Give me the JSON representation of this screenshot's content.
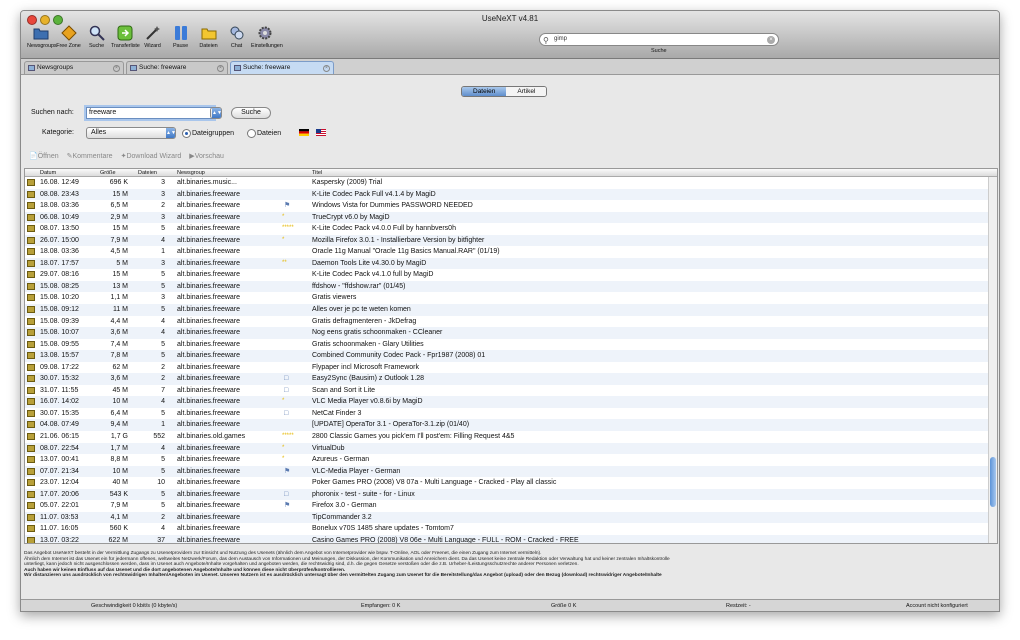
{
  "window": {
    "title": "UseNeXT v4.81"
  },
  "toolbar": [
    {
      "label": "Newsgroups",
      "icon": "folder-icon"
    },
    {
      "label": "Free Zone",
      "icon": "free-zone-icon"
    },
    {
      "label": "Suche",
      "icon": "search-icon"
    },
    {
      "label": "Transferliste",
      "icon": "transfer-icon"
    },
    {
      "label": "Wizard",
      "icon": "wizard-icon"
    },
    {
      "label": "Pause",
      "icon": "pause-icon"
    },
    {
      "label": "Dateien",
      "icon": "folder-icon"
    },
    {
      "label": "Chat",
      "icon": "chat-icon"
    },
    {
      "label": "Einstellungen",
      "icon": "gear-icon"
    }
  ],
  "search": {
    "value": "gimp",
    "label": "Suche"
  },
  "tabs": [
    {
      "label": "Newsgroups"
    },
    {
      "label": "Suche: freeware"
    },
    {
      "label": "Suche: freeware"
    }
  ],
  "segments": {
    "files": "Dateien",
    "articles": "Artikel"
  },
  "form": {
    "search_label": "Suchen nach:",
    "search_value": "freeware",
    "search_button": "Suche",
    "category_label": "Kategorie:",
    "category_value": "Alles",
    "radio_groups": "Dateigruppen",
    "radio_files": "Dateien"
  },
  "actions": [
    "Öffnen",
    "Kommentare",
    "Download Wizard",
    "Vorschau"
  ],
  "columns": {
    "date": "Datum",
    "size": "Größe",
    "files": "Dateien",
    "group": "Newsgroup",
    "title": "Titel"
  },
  "rows": [
    {
      "date": "16.08. 12:49",
      "size": "696 K",
      "files": "3",
      "group": "alt.binaries.music...",
      "mark": "",
      "title": "Kaspersky (2009) Trial"
    },
    {
      "date": "08.08. 23:43",
      "size": "15 M",
      "files": "3",
      "group": "alt.binaries.freeware",
      "mark": "",
      "title": "K-Lite Codec Pack Full v4.1.4 by MagiD"
    },
    {
      "date": "18.08. 03:36",
      "size": "6,5 M",
      "files": "2",
      "group": "alt.binaries.freeware",
      "mark": "flag",
      "title": "Windows Vista for Dummies   PASSWORD NEEDED"
    },
    {
      "date": "06.08. 10:49",
      "size": "2,9 M",
      "files": "3",
      "group": "alt.binaries.freeware",
      "mark": "*",
      "title": "TrueCrypt v6.0 by MagiD"
    },
    {
      "date": "08.07. 13:50",
      "size": "15 M",
      "files": "5",
      "group": "alt.binaries.freeware",
      "mark": "*****",
      "title": "K-Lite Codec Pack v4.0.0 Full by hannbvers0h"
    },
    {
      "date": "26.07. 15:00",
      "size": "7,9 M",
      "files": "4",
      "group": "alt.binaries.freeware",
      "mark": "*",
      "title": "Mozilla Firefox 3.0.1 - Installierbare Version by bitfighter"
    },
    {
      "date": "18.08. 03:36",
      "size": "4,5 M",
      "files": "1",
      "group": "alt.binaries.freeware",
      "mark": "",
      "title": "Oracle 11g Manual \"Oracle 11g Basics Manual.RAR\" (01/19)"
    },
    {
      "date": "18.07. 17:57",
      "size": "5 M",
      "files": "3",
      "group": "alt.binaries.freeware",
      "mark": "**",
      "title": "Daemon Tools Lite v4.30.0 by MagiD"
    },
    {
      "date": "29.07. 08:16",
      "size": "15 M",
      "files": "5",
      "group": "alt.binaries.freeware",
      "mark": "",
      "title": "K-Lite Codec Pack v4.1.0 full by MagiD"
    },
    {
      "date": "15.08. 08:25",
      "size": "13 M",
      "files": "5",
      "group": "alt.binaries.freeware",
      "mark": "",
      "title": "ffdshow - \"ffdshow.rar\" (01/45)"
    },
    {
      "date": "15.08. 10:20",
      "size": "1,1 M",
      "files": "3",
      "group": "alt.binaries.freeware",
      "mark": "",
      "title": "Gratis viewers"
    },
    {
      "date": "15.08. 09:12",
      "size": "11 M",
      "files": "5",
      "group": "alt.binaries.freeware",
      "mark": "",
      "title": "Alles over je pc te weten komen"
    },
    {
      "date": "15.08. 09:39",
      "size": "4,4 M",
      "files": "4",
      "group": "alt.binaries.freeware",
      "mark": "",
      "title": "Gratis defragmenteren - JkDefrag"
    },
    {
      "date": "15.08. 10:07",
      "size": "3,6 M",
      "files": "4",
      "group": "alt.binaries.freeware",
      "mark": "",
      "title": "Nog eens gratis schoonmaken - CCleaner"
    },
    {
      "date": "15.08. 09:55",
      "size": "7,4 M",
      "files": "5",
      "group": "alt.binaries.freeware",
      "mark": "",
      "title": "Gratis schoonmaken - Glary Utilities"
    },
    {
      "date": "13.08. 15:57",
      "size": "7,8 M",
      "files": "5",
      "group": "alt.binaries.freeware",
      "mark": "",
      "title": "Combined Community Codec Pack - Fpr1987 (2008) 01"
    },
    {
      "date": "09.08. 17:22",
      "size": "62 M",
      "files": "2",
      "group": "alt.binaries.freeware",
      "mark": "",
      "title": "Flypaper incl Microsoft Framework"
    },
    {
      "date": "30.07. 15:32",
      "size": "3,6 M",
      "files": "2",
      "group": "alt.binaries.freeware",
      "mark": "box",
      "title": "Easy2Sync (Bausim) z Outlook 1.28"
    },
    {
      "date": "31.07. 11:55",
      "size": "45 M",
      "files": "7",
      "group": "alt.binaries.freeware",
      "mark": "box",
      "title": "Scan and Sort it Lite"
    },
    {
      "date": "16.07. 14:02",
      "size": "10 M",
      "files": "4",
      "group": "alt.binaries.freeware",
      "mark": "*",
      "title": "VLC Media Player v0.8.6i by MagiD"
    },
    {
      "date": "30.07. 15:35",
      "size": "6,4 M",
      "files": "5",
      "group": "alt.binaries.freeware",
      "mark": "box",
      "title": "NetCat Finder 3"
    },
    {
      "date": "04.08. 07:49",
      "size": "9,4 M",
      "files": "1",
      "group": "alt.binaries.freeware",
      "mark": "",
      "title": "[UPDATE] OperaTor 3.1 - OperaTor-3.1.zip (01/40)"
    },
    {
      "date": "21.06. 06:15",
      "size": "1,7 G",
      "files": "552",
      "group": "alt.binaries.old.games",
      "mark": "*****",
      "title": "2800 Classic Games you pick'em I'll post'em: Filling Request 4&5"
    },
    {
      "date": "08.07. 22:54",
      "size": "1,7 M",
      "files": "4",
      "group": "alt.binaries.freeware",
      "mark": "*",
      "title": "VirtualDub"
    },
    {
      "date": "13.07. 00:41",
      "size": "8,8 M",
      "files": "5",
      "group": "alt.binaries.freeware",
      "mark": "*",
      "title": "Azureus - German"
    },
    {
      "date": "07.07. 21:34",
      "size": "10 M",
      "files": "5",
      "group": "alt.binaries.freeware",
      "mark": "flag",
      "title": "VLC-Media Player - German"
    },
    {
      "date": "23.07. 12:04",
      "size": "40 M",
      "files": "10",
      "group": "alt.binaries.freeware",
      "mark": "",
      "title": "Poker Games PRO (2008) V8 07a - Multi Language - Cracked - Play all classic"
    },
    {
      "date": "17.07. 20:06",
      "size": "543 K",
      "files": "5",
      "group": "alt.binaries.freeware",
      "mark": "box",
      "title": "phoronix - test - suite - for - Linux"
    },
    {
      "date": "05.07. 22:01",
      "size": "7,9 M",
      "files": "5",
      "group": "alt.binaries.freeware",
      "mark": "flag",
      "title": "Firefox 3.0 - German"
    },
    {
      "date": "11.07. 03:53",
      "size": "4,1 M",
      "files": "2",
      "group": "alt.binaries.freeware",
      "mark": "",
      "title": "TipCommander 3.2"
    },
    {
      "date": "11.07. 16:05",
      "size": "560 K",
      "files": "4",
      "group": "alt.binaries.freeware",
      "mark": "",
      "title": "Bonelux v70S 1485 share updates - Tomtom7"
    },
    {
      "date": "13.07. 03:22",
      "size": "622 M",
      "files": "37",
      "group": "alt.binaries.freeware",
      "mark": "",
      "title": "Casino Games PRO (2008) V8 06e - Multi Language - FULL - ROM - Cracked - FREE"
    }
  ],
  "footer": [
    "Das Angebot UseNeXT besteht in der Vermittlung Zugangs zu Usenetprovidern zur Einsicht und Nutzung des Usenets (ähnlich dem Angebot von Internetprovider wie bspw. T-Online, AOL oder Freenet, die einen Zugang zum Internet vermitteln).",
    "Ähnlich dem Internet ist das Usenet ein für jedermann offenes, weltweites Netzwerk/Forum, das dem Austausch von Informationen und Meinungen, der Diskussion, der Kommunikation und Anreichern dient. Da das Usenet keine zentrale Redaktion oder Verwaltung hat und keiner zentralen Inhaltskontrolle",
    "unterliegt, kann jedoch nicht ausgeschlossen werden, dass im Usenet auch Angebote/Inhalte vorgehalten und angeboten werden, die rechtswidrig sind, d.h. die gegen Gesetze verstoßen oder die z.B. Urheber-/Leistungsschutzrechte anderer Personen verletzen.",
    "Auch haben wir keinen Einfluss auf das Usenet und die dort angebotenen Angebote/Inhalte und können diese nicht überprüfen/kontrollieren.",
    "Wir distanzieren uns ausdrücklich von rechtswidrigen Inhalten/Angeboten im Usenet. Unseren Nutzern ist es ausdrücklich untersagt über den vermittelten Zugang zum Usenet für die Bereitstellung/das Angebot (upload) oder den Bezug (download) rechtswidriger Angebote/Inhalte"
  ],
  "status": {
    "speed": "Geschwindigkeit 0 kbit/s (0 kbyte/s)",
    "received": "Empfangen: 0 K",
    "size": "Größe 0 K",
    "rest": "Restzeit: -",
    "account": "Account nicht konfiguriert"
  }
}
